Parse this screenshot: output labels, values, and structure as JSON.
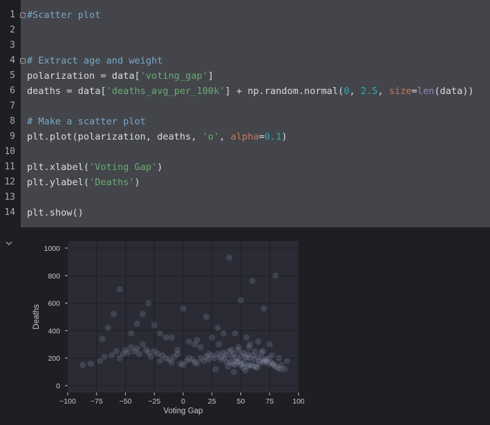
{
  "code": {
    "lines": [
      {
        "n": "1",
        "segs": [
          {
            "t": "#Scatter plot",
            "c": "cm"
          }
        ]
      },
      {
        "n": "2",
        "segs": []
      },
      {
        "n": "3",
        "segs": []
      },
      {
        "n": "4",
        "segs": [
          {
            "t": "# Extract age and weight",
            "c": "cm"
          }
        ]
      },
      {
        "n": "5",
        "segs": [
          {
            "t": "polarization = data["
          },
          {
            "t": "'voting_gap'",
            "c": "str"
          },
          {
            "t": "]"
          }
        ]
      },
      {
        "n": "6",
        "segs": [
          {
            "t": "deaths = data["
          },
          {
            "t": "'deaths_avg_per_100k'",
            "c": "str"
          },
          {
            "t": "] + np.random.normal("
          },
          {
            "t": "0",
            "c": "num"
          },
          {
            "t": ", "
          },
          {
            "t": "2.5",
            "c": "num"
          },
          {
            "t": ", "
          },
          {
            "t": "size",
            "c": "kw"
          },
          {
            "t": "="
          },
          {
            "t": "len",
            "c": "fn"
          },
          {
            "t": "(data))"
          }
        ]
      },
      {
        "n": "7",
        "segs": []
      },
      {
        "n": "8",
        "segs": [
          {
            "t": "# Make a scatter plot",
            "c": "cm"
          }
        ]
      },
      {
        "n": "9",
        "segs": [
          {
            "t": "plt.plot(polarization, deaths, "
          },
          {
            "t": "'o'",
            "c": "str"
          },
          {
            "t": ", "
          },
          {
            "t": "alpha",
            "c": "kw"
          },
          {
            "t": "="
          },
          {
            "t": "0.1",
            "c": "num"
          },
          {
            "t": ")"
          }
        ]
      },
      {
        "n": "10",
        "segs": []
      },
      {
        "n": "11",
        "segs": [
          {
            "t": "plt.xlabel("
          },
          {
            "t": "'Voting Gap'",
            "c": "str"
          },
          {
            "t": ")"
          }
        ]
      },
      {
        "n": "12",
        "segs": [
          {
            "t": "plt.ylabel("
          },
          {
            "t": "'Deaths'",
            "c": "str"
          },
          {
            "t": ")"
          }
        ]
      },
      {
        "n": "13",
        "segs": []
      },
      {
        "n": "14",
        "segs": [
          {
            "t": "plt.show()"
          }
        ]
      }
    ]
  },
  "output_toggle_icon": "chevron-down-icon",
  "colors": {
    "plot_bg": "#2a2b35",
    "grid": "#1e1f22",
    "point": "#a5b4cc",
    "axis_text": "#c8c9cc"
  },
  "chart_data": {
    "type": "scatter",
    "xlabel": "Voting Gap",
    "ylabel": "Deaths",
    "xlim": [
      -100,
      100
    ],
    "ylim": [
      -50,
      1050
    ],
    "xticks": [
      -100,
      -75,
      -50,
      -25,
      0,
      25,
      50,
      75,
      100
    ],
    "xtick_labels": [
      "−100",
      "−75",
      "−50",
      "−25",
      "0",
      "25",
      "50",
      "75",
      "100"
    ],
    "yticks": [
      0,
      200,
      400,
      600,
      800,
      1000
    ],
    "grid": true,
    "alpha": 0.1,
    "marker": "o",
    "points": {
      "x": [
        -87,
        -80,
        -72,
        -68,
        -62,
        -58,
        -55,
        -52,
        -50,
        -48,
        -45,
        -42,
        -40,
        -38,
        -35,
        -32,
        -30,
        -28,
        -25,
        -22,
        -20,
        -18,
        -15,
        -12,
        -10,
        -8,
        -5,
        -2,
        0,
        3,
        5,
        8,
        10,
        12,
        15,
        18,
        20,
        22,
        25,
        27,
        30,
        32,
        35,
        37,
        40,
        42,
        44,
        46,
        48,
        50,
        52,
        54,
        56,
        58,
        60,
        62,
        64,
        66,
        68,
        70,
        72,
        74,
        76,
        78,
        80,
        82,
        85,
        88,
        -65,
        -40,
        -15,
        10,
        30,
        45,
        55,
        65,
        75,
        -30,
        20,
        50,
        70,
        -55,
        0,
        40,
        60,
        80,
        35,
        48,
        58,
        62,
        45,
        52,
        38,
        56,
        66,
        72,
        28,
        44,
        54,
        -20,
        15,
        5,
        25,
        42,
        68,
        74,
        -10,
        -35,
        33,
        47,
        53,
        57,
        63,
        49,
        51,
        41,
        59,
        61,
        43,
        55,
        46,
        50,
        39,
        64,
        -70,
        -45,
        -5,
        22,
        36,
        70,
        78,
        84,
        -60,
        -25,
        12,
        31,
        57,
        69,
        77,
        83,
        90
      ],
      "y": [
        150,
        160,
        180,
        210,
        220,
        250,
        200,
        230,
        260,
        240,
        280,
        250,
        270,
        230,
        300,
        260,
        240,
        210,
        250,
        230,
        180,
        220,
        200,
        190,
        170,
        210,
        230,
        160,
        150,
        180,
        200,
        190,
        170,
        160,
        200,
        180,
        210,
        190,
        220,
        200,
        230,
        210,
        240,
        220,
        250,
        210,
        230,
        200,
        260,
        220,
        240,
        210,
        230,
        200,
        220,
        190,
        210,
        180,
        200,
        170,
        190,
        160,
        170,
        150,
        140,
        130,
        150,
        120,
        420,
        450,
        350,
        300,
        420,
        380,
        350,
        320,
        300,
        600,
        500,
        620,
        560,
        700,
        560,
        930,
        760,
        800,
        380,
        280,
        300,
        250,
        150,
        130,
        170,
        140,
        160,
        180,
        120,
        100,
        110,
        380,
        280,
        320,
        350,
        260,
        240,
        200,
        350,
        520,
        190,
        170,
        160,
        150,
        140,
        180,
        160,
        170,
        150,
        140,
        160,
        200,
        180,
        150,
        140,
        130,
        340,
        380,
        260,
        230,
        200,
        180,
        160,
        120,
        520,
        440,
        330,
        300,
        280,
        250,
        220,
        200,
        180
      ]
    }
  }
}
